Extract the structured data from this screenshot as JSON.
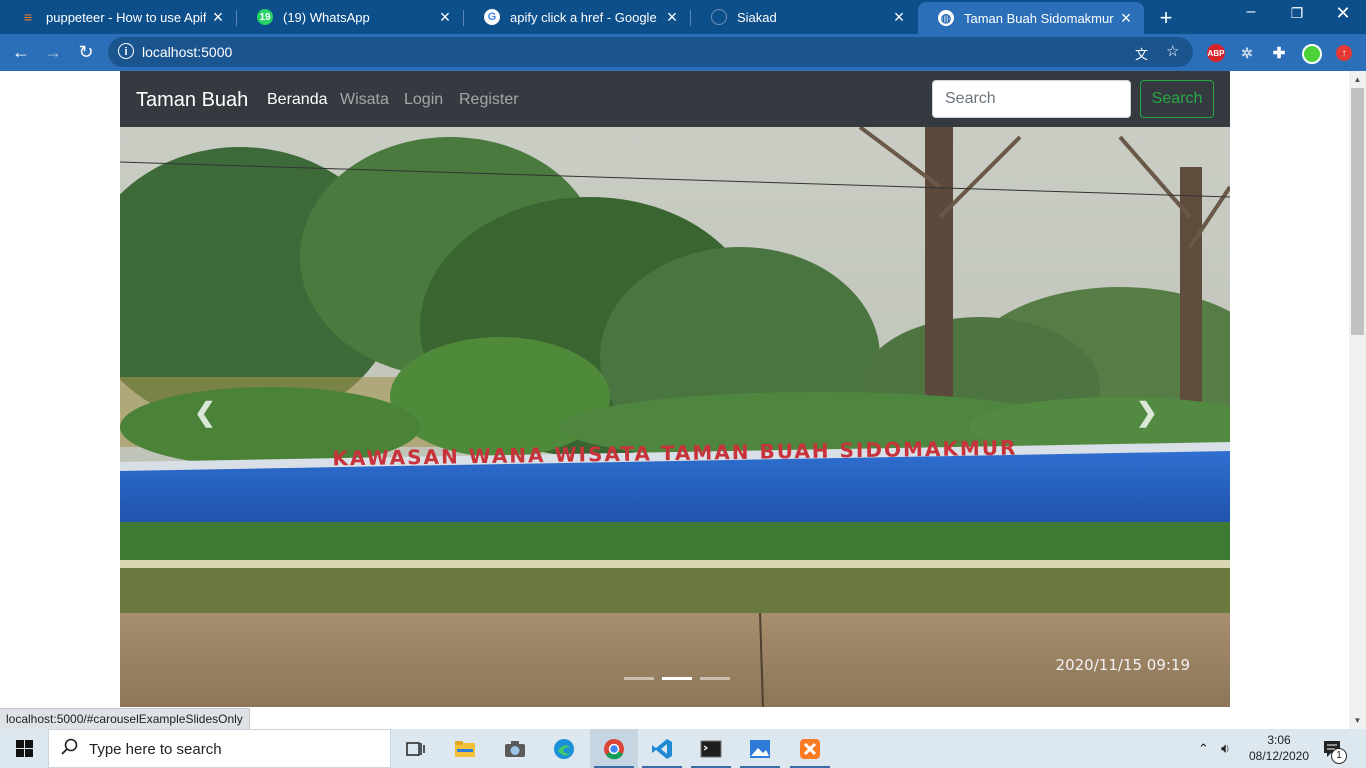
{
  "browser": {
    "tabs": [
      {
        "title": "puppeteer - How to use Apify",
        "favicon": "stackoverflow-icon",
        "color": "#f48024"
      },
      {
        "title": "(19) WhatsApp",
        "favicon": "whatsapp-icon",
        "color": "#25d366",
        "badge": "19"
      },
      {
        "title": "apify click a href - Google Search",
        "favicon": "google-icon",
        "color": "#ffffff"
      },
      {
        "title": "Siakad",
        "favicon": "siakad-icon",
        "color": "#6f8fb5"
      },
      {
        "title": "Taman Buah Sidomakmur",
        "favicon": "globe-icon",
        "color": "#ffffff"
      }
    ],
    "url": "localhost:5000",
    "status_url": "localhost:5000/#carouselExampleSlidesOnly",
    "extensions": [
      {
        "name": "adblock-plus-icon",
        "label": "ABP",
        "color": "#d8222a"
      },
      {
        "name": "bug-icon",
        "label": "",
        "color": "#2a6fb7"
      },
      {
        "name": "puzzle-icon",
        "label": "",
        "color": "#2a6fb7"
      },
      {
        "name": "profile-avatar",
        "label": "",
        "color": "#4cd137"
      },
      {
        "name": "update-icon",
        "label": "",
        "color": "#e53935"
      }
    ]
  },
  "site": {
    "brand": "Taman Buah",
    "nav": [
      "Beranda",
      "Wisata",
      "Login",
      "Register"
    ],
    "search_placeholder": "Search",
    "search_button": "Search",
    "slide": {
      "sign_text": "KAWASAN WANA WISATA TAMAN BUAH SIDOMAKMUR",
      "timestamp": "2020/11/15 09:19"
    }
  },
  "taskbar": {
    "search_placeholder": "Type here to search",
    "time": "3:06",
    "date": "08/12/2020",
    "notification_count": "1",
    "apps": [
      "task-view-icon",
      "file-explorer-icon",
      "camera-icon",
      "edge-icon",
      "chrome-icon",
      "vscode-icon",
      "terminal-icon",
      "photos-icon",
      "xampp-icon"
    ]
  }
}
